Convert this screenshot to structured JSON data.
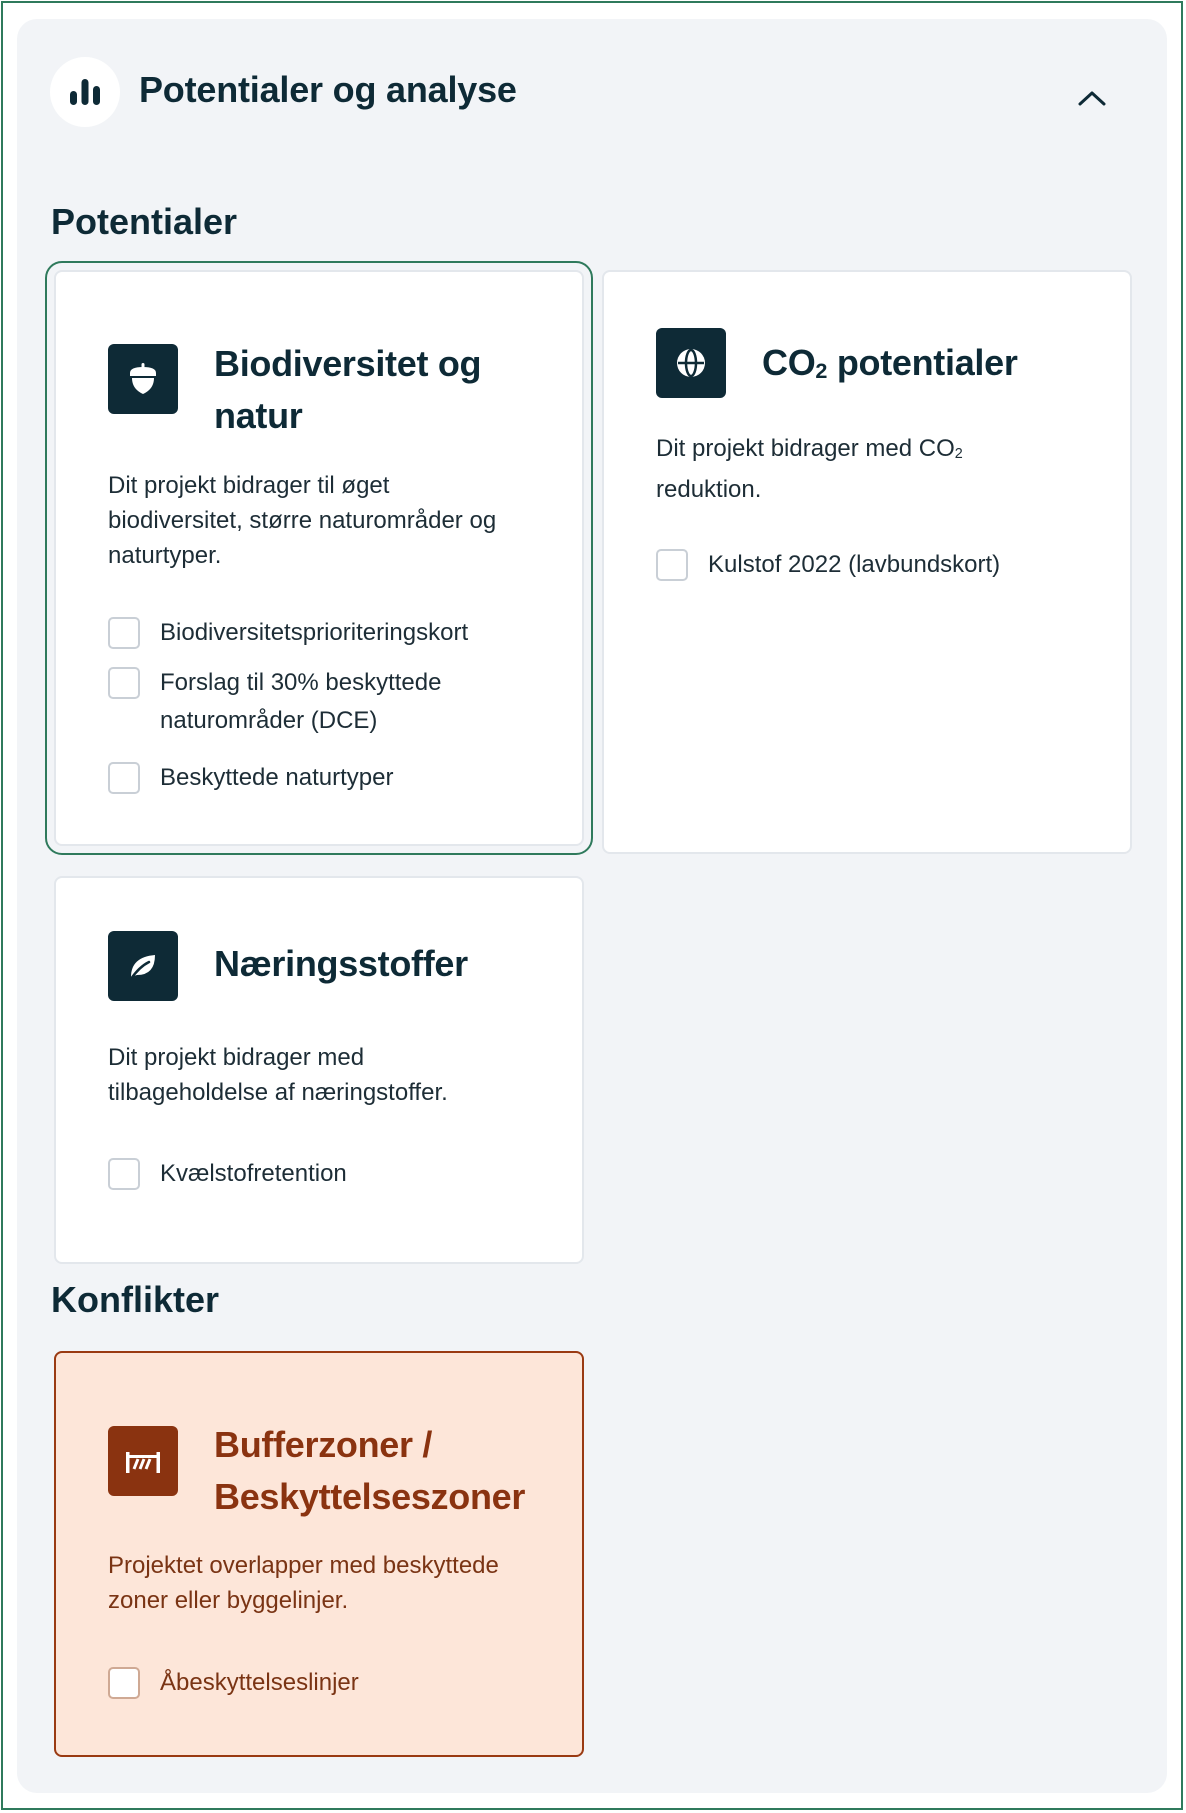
{
  "header": {
    "title": "Potentialer og analyse",
    "icon": "bar-chart-icon",
    "collapse_icon": "chevron-up-icon"
  },
  "sections": {
    "potentials_title": "Potentialer",
    "conflicts_title": "Konflikter"
  },
  "cards": {
    "biodiversity": {
      "icon": "acorn-icon",
      "title_line1": "Biodiversitet og",
      "title_line2": "natur",
      "description": "Dit projekt bidrager til øget biodiversitet, større naturområder og naturtyper.",
      "options": [
        {
          "label": "Biodiversitetsprioriteringskort",
          "checked": false
        },
        {
          "label": "Forslag til 30% beskyttede naturområder (DCE)",
          "checked": false
        },
        {
          "label": "Beskyttede naturtyper",
          "checked": false
        }
      ]
    },
    "co2": {
      "icon": "globe-icon",
      "title_prefix": "CO",
      "title_sub": "2",
      "title_suffix": " potentialer",
      "desc_prefix": "Dit projekt bidrager med CO",
      "desc_sub": "2",
      "desc_suffix": " reduktion.",
      "options": [
        {
          "label": "Kulstof 2022 (lavbundskort)",
          "checked": false
        }
      ]
    },
    "nutrients": {
      "icon": "leaf-icon",
      "title": "Næringsstoffer",
      "description": "Dit projekt bidrager med tilbageholdelse af næringstoffer.",
      "options": [
        {
          "label": "Kvælstofretention",
          "checked": false
        }
      ]
    },
    "buffer": {
      "icon": "fence-icon",
      "title_line1": "Bufferzoner /",
      "title_line2": "Beskyttelseszoner",
      "description": "Projektet overlapper med beskyttede zoner eller byggelinjer.",
      "options": [
        {
          "label": "Åbeskyttelseslinjer",
          "checked": false
        }
      ]
    }
  },
  "colors": {
    "accent_green": "#2f7a5c",
    "navy": "#0e2a36",
    "conflict_bg": "#fde6d9",
    "conflict_fg": "#8a3310"
  }
}
